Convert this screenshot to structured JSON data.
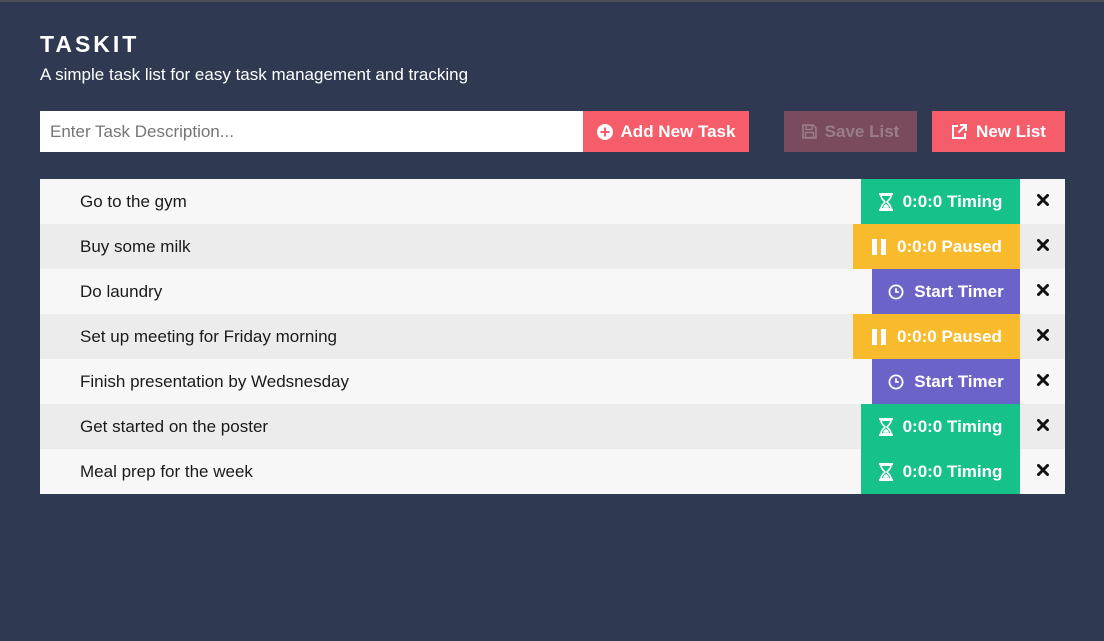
{
  "app": {
    "title": "TASKIT",
    "subtitle": "A simple task list for easy task management and tracking"
  },
  "toolbar": {
    "input_placeholder": "Enter Task Description...",
    "add_label": "Add New Task",
    "save_label": "Save List",
    "new_label": "New List"
  },
  "colors": {
    "background": "#2f3a52",
    "accent": "#f55d6b",
    "timing": "#17c28a",
    "paused": "#f8bb2d",
    "start": "#6c63c9"
  },
  "tasks": [
    {
      "text": "Go to the gym",
      "timer_label": "0:0:0 Timing",
      "status": "timing",
      "icon": "hourglass-icon"
    },
    {
      "text": "Buy some milk",
      "timer_label": "0:0:0 Paused",
      "status": "paused",
      "icon": "pause-icon"
    },
    {
      "text": "Do laundry",
      "timer_label": "Start Timer",
      "status": "start",
      "icon": "clock-icon"
    },
    {
      "text": "Set up meeting for Friday morning",
      "timer_label": "0:0:0 Paused",
      "status": "paused",
      "icon": "pause-icon"
    },
    {
      "text": "Finish presentation by Wedsnesday",
      "timer_label": "Start Timer",
      "status": "start",
      "icon": "clock-icon"
    },
    {
      "text": "Get started on the poster",
      "timer_label": "0:0:0 Timing",
      "status": "timing",
      "icon": "hourglass-icon"
    },
    {
      "text": "Meal prep for the week",
      "timer_label": "0:0:0 Timing",
      "status": "timing",
      "icon": "hourglass-icon"
    }
  ]
}
